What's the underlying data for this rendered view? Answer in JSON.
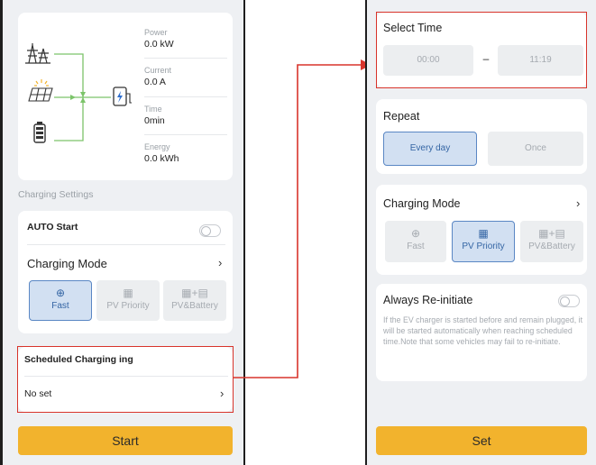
{
  "left": {
    "stats": {
      "power_label": "Power",
      "power_value": "0.0 kW",
      "current_label": "Current",
      "current_value": "0.0 A",
      "time_label": "Time",
      "time_value": "0min",
      "energy_label": "Energy",
      "energy_value": "0.0 kWh"
    },
    "section_title": "Charging Settings",
    "auto_start_label": "AUTO Start",
    "auto_start_on": false,
    "charging_mode_label": "Charging Mode",
    "modes": [
      {
        "label": "Fast",
        "icon": "plug-icon",
        "selected": true
      },
      {
        "label": "PV Priority",
        "icon": "solar-panel-icon",
        "selected": false
      },
      {
        "label": "PV&Battery",
        "icon": "solar-battery-icon",
        "selected": false
      }
    ],
    "scheduled_title": "Scheduled Charging ing",
    "scheduled_value": "No set",
    "start_button": "Start"
  },
  "right": {
    "select_time_title": "Select Time",
    "time_start": "00:00",
    "time_dash": "–",
    "time_end": "11:19",
    "repeat_title": "Repeat",
    "repeat_options": [
      {
        "label": "Every day",
        "selected": true
      },
      {
        "label": "Once",
        "selected": false
      }
    ],
    "charging_mode_label": "Charging Mode",
    "modes": [
      {
        "label": "Fast",
        "icon": "plug-icon",
        "selected": false
      },
      {
        "label": "PV Priority",
        "icon": "solar-panel-icon",
        "selected": true
      },
      {
        "label": "PV&Battery",
        "icon": "solar-battery-icon",
        "selected": false
      }
    ],
    "reinitiate_title": "Always Re-initiate",
    "reinitiate_on": false,
    "reinitiate_note": "If the EV charger is started before and remain plugged, it will be started automatically when reaching scheduled time.Note that some vehicles may fail to re-initiate.",
    "set_button": "Set"
  },
  "colors": {
    "accent": "#f2b32d",
    "highlight": "#d8342b",
    "selected_mode": "#d2e0f2",
    "flow_line": "#7cc46a"
  }
}
